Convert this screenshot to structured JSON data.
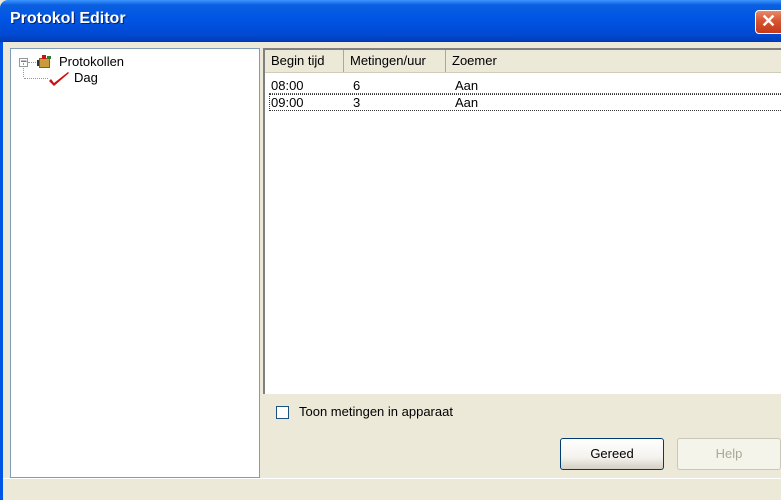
{
  "window": {
    "title": "Protokol Editor"
  },
  "tree": {
    "root_label": "Protokollen",
    "expander_symbol": "−",
    "children": [
      {
        "label": "Dag",
        "icon": "red-check-icon"
      }
    ]
  },
  "table": {
    "columns": [
      "Begin tijd",
      "Metingen/uur",
      "Zoemer"
    ],
    "rows": [
      {
        "begin": "08:00",
        "metingen": "6",
        "zoemer": "Aan"
      },
      {
        "begin": "09:00",
        "metingen": "3",
        "zoemer": "Aan"
      }
    ]
  },
  "options": {
    "show_measurements_label": "Toon metingen in apparaat",
    "show_measurements_checked": false
  },
  "buttons": {
    "done_label": "Gereed",
    "help_label": "Help"
  },
  "colors": {
    "titlebar": "#0055E5",
    "close_button": "#D7552F",
    "check_mark": "#D01010"
  }
}
